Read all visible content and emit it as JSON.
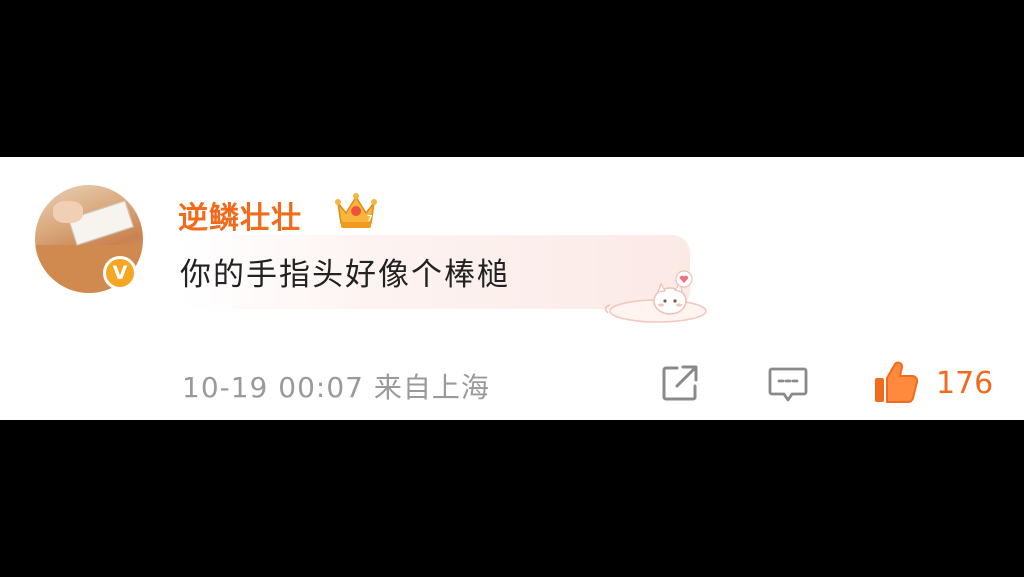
{
  "comment": {
    "username": "逆鳞壮壮",
    "text": "你的手指头好像个棒槌",
    "datetime": "10-19 00:07",
    "location": "来自上海",
    "like_count": "176",
    "verified_badge_label": "V"
  },
  "icons": {
    "crown": "crown-icon",
    "share": "share-icon",
    "reply": "comment-icon",
    "like": "thumbs-up-icon",
    "sticker": "cat-sticker-icon"
  },
  "colors": {
    "username": "#f26b1d",
    "like_accent": "#f26b1d",
    "meta_gray": "#9a9a9a",
    "badge": "#f5a623"
  }
}
